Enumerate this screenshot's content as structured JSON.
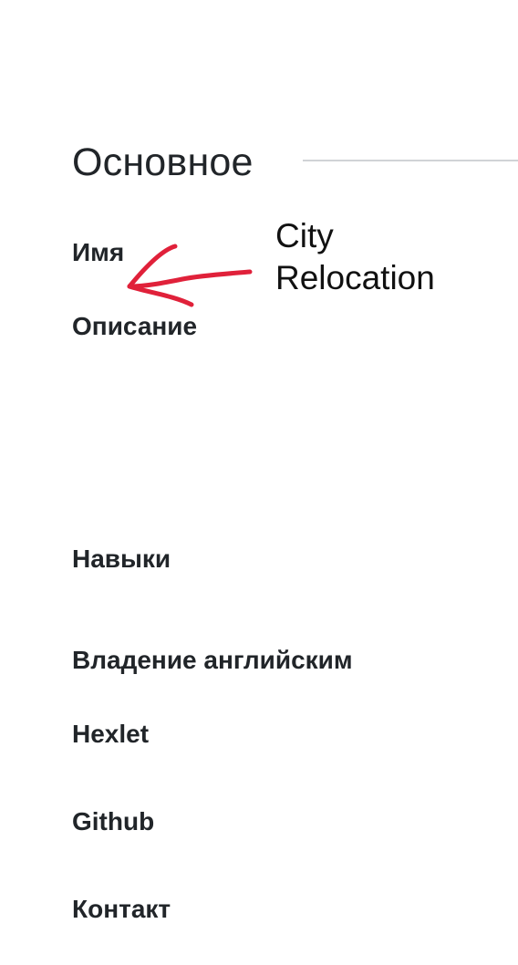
{
  "section": {
    "title": "Основное"
  },
  "fields": {
    "name_label": "Имя",
    "description_label": "Описание",
    "skills_label": "Навыки",
    "english_label": "Владение английским",
    "hexlet_label": "Hexlet",
    "github_label": "Github",
    "contact_label": "Контакт"
  },
  "annotation": {
    "line1": "City",
    "line2": "Relocation",
    "arrow_color": "#e0213a",
    "arrow_icon": "hand-drawn-arrow-left-icon"
  },
  "colors": {
    "text": "#212529",
    "rule": "#d0d3d6",
    "background": "#ffffff"
  }
}
